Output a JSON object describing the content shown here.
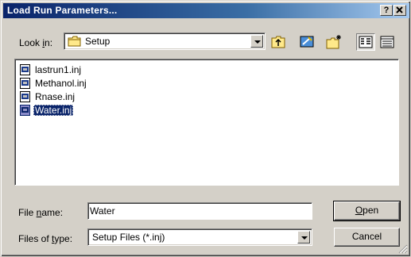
{
  "window": {
    "title": "Load Run Parameters...",
    "help_label": "?",
    "close_label": "✕"
  },
  "look_in": {
    "label_pre": "Look ",
    "label_key": "i",
    "label_post": "n:",
    "value": "Setup",
    "icon": "folder-icon"
  },
  "toolbar": {
    "icons": [
      "up-one-level-icon",
      "desktop-icon",
      "new-folder-icon",
      "list-view-icon",
      "details-view-icon"
    ]
  },
  "files": [
    {
      "name": "lastrun1.inj",
      "icon": "inj-file-icon",
      "selected": false
    },
    {
      "name": "Methanol.inj",
      "icon": "inj-file-icon",
      "selected": false
    },
    {
      "name": "Rnase.inj",
      "icon": "inj-file-icon",
      "selected": false
    },
    {
      "name": "Water.inj",
      "icon": "inj-file-icon",
      "selected": true
    }
  ],
  "file_name": {
    "label_pre": "File ",
    "label_key": "n",
    "label_post": "ame:",
    "value": "Water"
  },
  "file_type": {
    "label_pre": "Files of ",
    "label_key": "t",
    "label_post": "ype:",
    "value": "Setup Files (*.inj)"
  },
  "buttons": {
    "open_key": "O",
    "open_rest": "pen",
    "cancel": "Cancel"
  },
  "colors": {
    "title_bar": "#0a246a",
    "face": "#d4d0c8",
    "selection": "#0a246a"
  }
}
